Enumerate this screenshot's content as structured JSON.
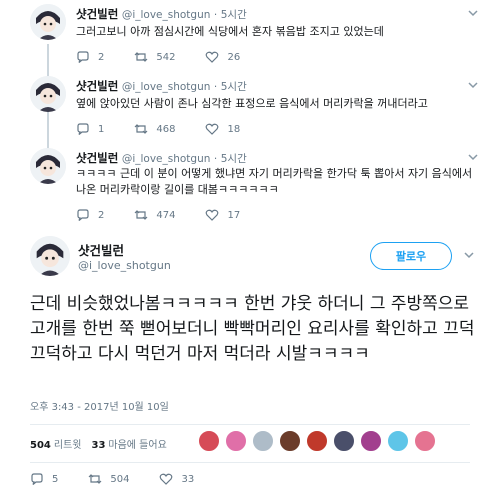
{
  "thread": [
    {
      "name": "샷건빌런",
      "handle": "@i_love_shotgun",
      "time": "5시간",
      "text": "그러고보니 아까 점심시간에 식당에서 혼자 볶음밥 조지고 있었는데",
      "replies": "2",
      "retweets": "542",
      "likes": "26"
    },
    {
      "name": "샷건빌런",
      "handle": "@i_love_shotgun",
      "time": "5시간",
      "text": "옆에 앉아있던 사람이 존나 심각한 표정으로 음식에서 머리카락을 꺼내더라고",
      "replies": "1",
      "retweets": "468",
      "likes": "18"
    },
    {
      "name": "샷건빌런",
      "handle": "@i_love_shotgun",
      "time": "5시간",
      "text": "ㅋㅋㅋㅋ 근데 이 분이 어떻게 했냐면 자기 머리카락을 한가닥 툭 뽑아서 자기 음식에서 나온 머리카락이랑 길이를 대봄ㅋㅋㅋㅋㅋㅋ",
      "replies": "2",
      "retweets": "474",
      "likes": "17"
    }
  ],
  "main": {
    "name": "샷건빌런",
    "handle": "@i_love_shotgun",
    "follow_label": "팔로우",
    "text": "근데 비슷했었나봄ㅋㅋㅋㅋㅋ 한번 갸웃 하더니 그 주방쪽으로 고개를 한번 쭉 뻗어보더니 빡빡머리인 요리사를 확인하고 끄덕끄덕하고 다시 먹던거 마저 먹더라 시발ㅋㅋㅋㅋ",
    "timestamp": "오후 3:43 - 2017년 10월 10일",
    "retweet_count": "504",
    "retweet_label": "리트윗",
    "like_count": "33",
    "like_label": "마음에 들어요",
    "replies": "5",
    "retweets": "504",
    "likes": "33"
  },
  "colors": {
    "accent": "#1da1f2",
    "muted": "#657786",
    "liker_avatars": [
      "#d64b57",
      "#e06fa8",
      "#aebcc8",
      "#6b3c2a",
      "#c0392b",
      "#4a4f6a",
      "#a23f8e",
      "#5ec5e8",
      "#e57391"
    ]
  },
  "icons": {
    "reply": "speech-bubble-icon",
    "retweet": "retweet-arrows-icon",
    "like": "heart-icon",
    "more": "chevron-down-icon"
  }
}
